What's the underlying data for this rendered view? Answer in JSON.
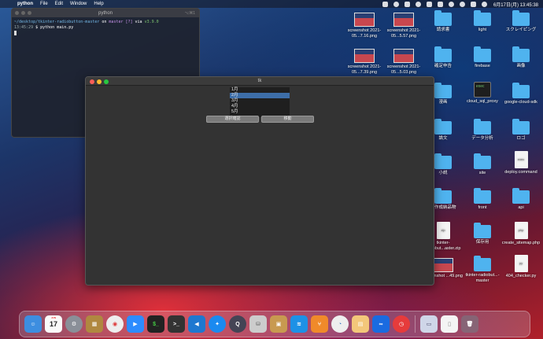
{
  "menubar": {
    "apple": "",
    "app_name": "python",
    "items": [
      "File",
      "Edit",
      "Window",
      "Help"
    ],
    "clock": "6月17日(月)  13:45:38"
  },
  "terminal": {
    "title": "python",
    "shortcut": "⌥⌘1",
    "line1_path": "~/desktop/tkinter-radiobutton-master",
    "line1_on": " on ",
    "line1_branch": "master [?]",
    "line1_via": " via ",
    "line1_version": "v3.9.0",
    "line2_time": "13:45:29",
    "line2_cmd": " $ python main.py"
  },
  "desktop_icons": [
    {
      "label": "screenshot 2021-05...7.16.png"
    },
    {
      "label": "screenshot 2021-05...5.57.png"
    },
    {
      "label": "請求書"
    },
    {
      "label": "light"
    },
    {
      "label": "スクレイピング"
    },
    {
      "label": "screenshot 2021-05...7.39.png"
    },
    {
      "label": "screenshot 2021-05...5.03.png"
    },
    {
      "label": "確定申告"
    },
    {
      "label": "firebase"
    },
    {
      "label": "画像"
    },
    {
      "label": "漫画"
    },
    {
      "label": "cloud_sql_proxy"
    },
    {
      "label": "google-cloud-sdk"
    },
    {
      "label": "論文"
    },
    {
      "label": "データ分析"
    },
    {
      "label": "ロゴ"
    },
    {
      "label": "小説"
    },
    {
      "label": "site"
    },
    {
      "label": "deploy.command"
    },
    {
      "label": "ト作成納品物"
    },
    {
      "label": "front"
    },
    {
      "label": "api"
    },
    {
      "label": "tkinter-radiobut...aster.zip"
    },
    {
      "label": "保存用"
    },
    {
      "label": "create_sitemap.php"
    },
    {
      "label": "screenshot ...49.png"
    },
    {
      "label": "tkinter-radiobut...-master"
    },
    {
      "label": "404_checker.py"
    }
  ],
  "tk_window": {
    "title": "tk",
    "list_options": [
      "1月",
      "2月",
      "3月",
      "4月",
      "5月"
    ],
    "selected_index": 1,
    "select_button": "選択確認",
    "move_button": "移動"
  },
  "dock": {
    "calendar_month": "JUN",
    "calendar_day": "17",
    "apps": [
      "finder",
      "calendar",
      "system-preferences",
      "launchpad",
      "chrome",
      "zoom",
      "terminal-iterm",
      "terminal",
      "vscode",
      "safari",
      "quicktime",
      "sequel",
      "preview-app",
      "docker",
      "sourcetree",
      "spotlight",
      "notes",
      "loop",
      "time-app",
      "photos",
      "document",
      "trash"
    ]
  },
  "colors": {
    "accent_selection": "#3d6ea8",
    "folder_blue": "#4fb3ef",
    "close": "#fe5f57",
    "minimize": "#febc2e",
    "zoom": "#28c840"
  }
}
